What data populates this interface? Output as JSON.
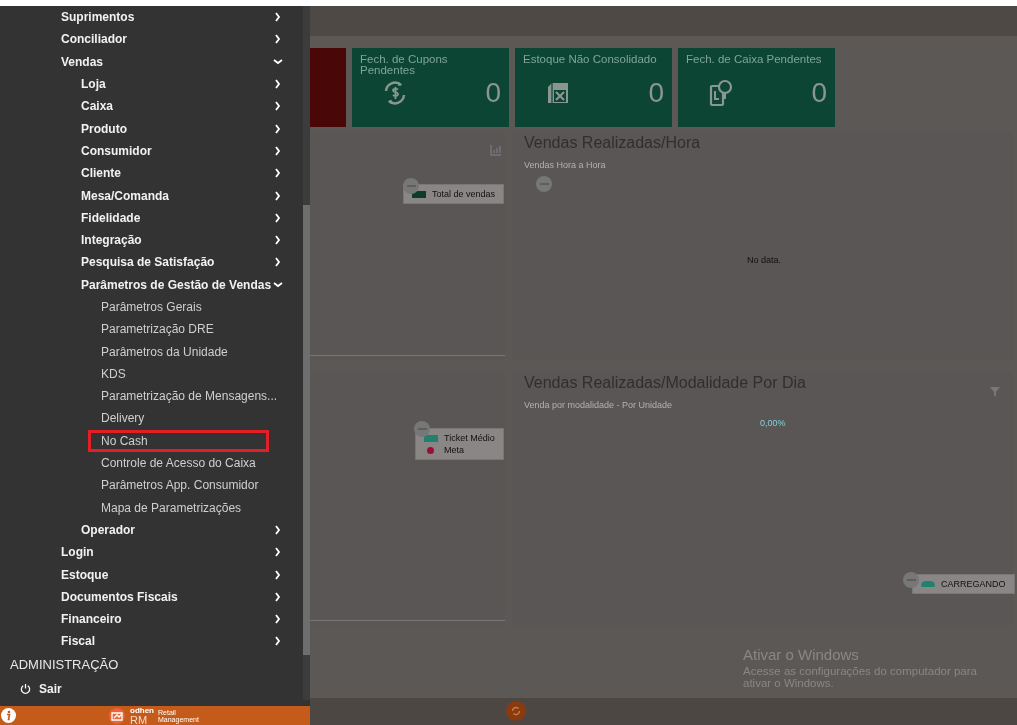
{
  "menu": {
    "items": [
      {
        "label": "Suprimentos",
        "expanded": false
      },
      {
        "label": "Conciliador",
        "expanded": false
      },
      {
        "label": "Vendas",
        "expanded": true,
        "children": [
          {
            "label": "Loja",
            "expanded": false
          },
          {
            "label": "Caixa",
            "expanded": false
          },
          {
            "label": "Produto",
            "expanded": false
          },
          {
            "label": "Consumidor",
            "expanded": false
          },
          {
            "label": "Cliente",
            "expanded": false
          },
          {
            "label": "Mesa/Comanda",
            "expanded": false
          },
          {
            "label": "Fidelidade",
            "expanded": false
          },
          {
            "label": "Integração",
            "expanded": false
          },
          {
            "label": "Pesquisa de Satisfação",
            "expanded": false
          },
          {
            "label": "Parâmetros de Gestão de Vendas",
            "expanded": true,
            "children": [
              {
                "label": "Parâmetros Gerais",
                "highlighted": false
              },
              {
                "label": "Parametrização DRE",
                "highlighted": false
              },
              {
                "label": "Parâmetros da Unidade",
                "highlighted": false
              },
              {
                "label": "KDS",
                "highlighted": false
              },
              {
                "label": "Parametrização de Mensagens...",
                "highlighted": false
              },
              {
                "label": "Delivery",
                "highlighted": false
              },
              {
                "label": "No Cash",
                "highlighted": true
              },
              {
                "label": "Controle de Acesso do Caixa",
                "highlighted": false
              },
              {
                "label": "Parâmetros App. Consumidor",
                "highlighted": false
              },
              {
                "label": "Mapa de Parametrizações",
                "highlighted": false
              }
            ]
          },
          {
            "label": "Operador",
            "expanded": false
          }
        ]
      },
      {
        "label": "Login",
        "expanded": false
      },
      {
        "label": "Estoque",
        "expanded": false
      },
      {
        "label": "Documentos Fiscais",
        "expanded": false
      },
      {
        "label": "Financeiro",
        "expanded": false
      },
      {
        "label": "Fiscal",
        "expanded": false
      }
    ],
    "section": "ADMINISTRAÇÃO",
    "logout": "Sair"
  },
  "brand": {
    "word": "odhen",
    "letters": "RM",
    "tagline": "Retail Management"
  },
  "cards": [
    {
      "kind": "alert"
    },
    {
      "kind": "ok",
      "title": "Fech. de Cupons Pendentes",
      "value": "0"
    },
    {
      "kind": "ok",
      "title": "Estoque Não Consolidado",
      "value": "0"
    },
    {
      "kind": "ok",
      "title": "Fech. de Caixa Pendentes",
      "value": "0"
    }
  ],
  "panels": [
    {
      "legend": [
        {
          "label": "Total de vendas",
          "kind": "square",
          "color": "#0e3b2c"
        }
      ]
    },
    {
      "title": "Vendas Realizadas/Hora",
      "subtitle": "Vendas Hora a Hora",
      "message": "No data."
    },
    {
      "legend": [
        {
          "label": "Ticket Médio",
          "kind": "square",
          "color": "#22806f"
        },
        {
          "label": "Meta",
          "kind": "dot",
          "color": "#9c0f35"
        }
      ]
    },
    {
      "title": "Vendas Realizadas/Modalidade Por Dia",
      "subtitle": "Venda por modalidade - Por Unidade",
      "percent": "0,00%",
      "legend": [
        {
          "label": "CARREGANDO",
          "kind": "cloud",
          "color": "#22806f"
        }
      ]
    }
  ],
  "activation": {
    "title": "Ativar o Windows",
    "text": "Acesse as configurações do computador para ativar o Windows."
  }
}
